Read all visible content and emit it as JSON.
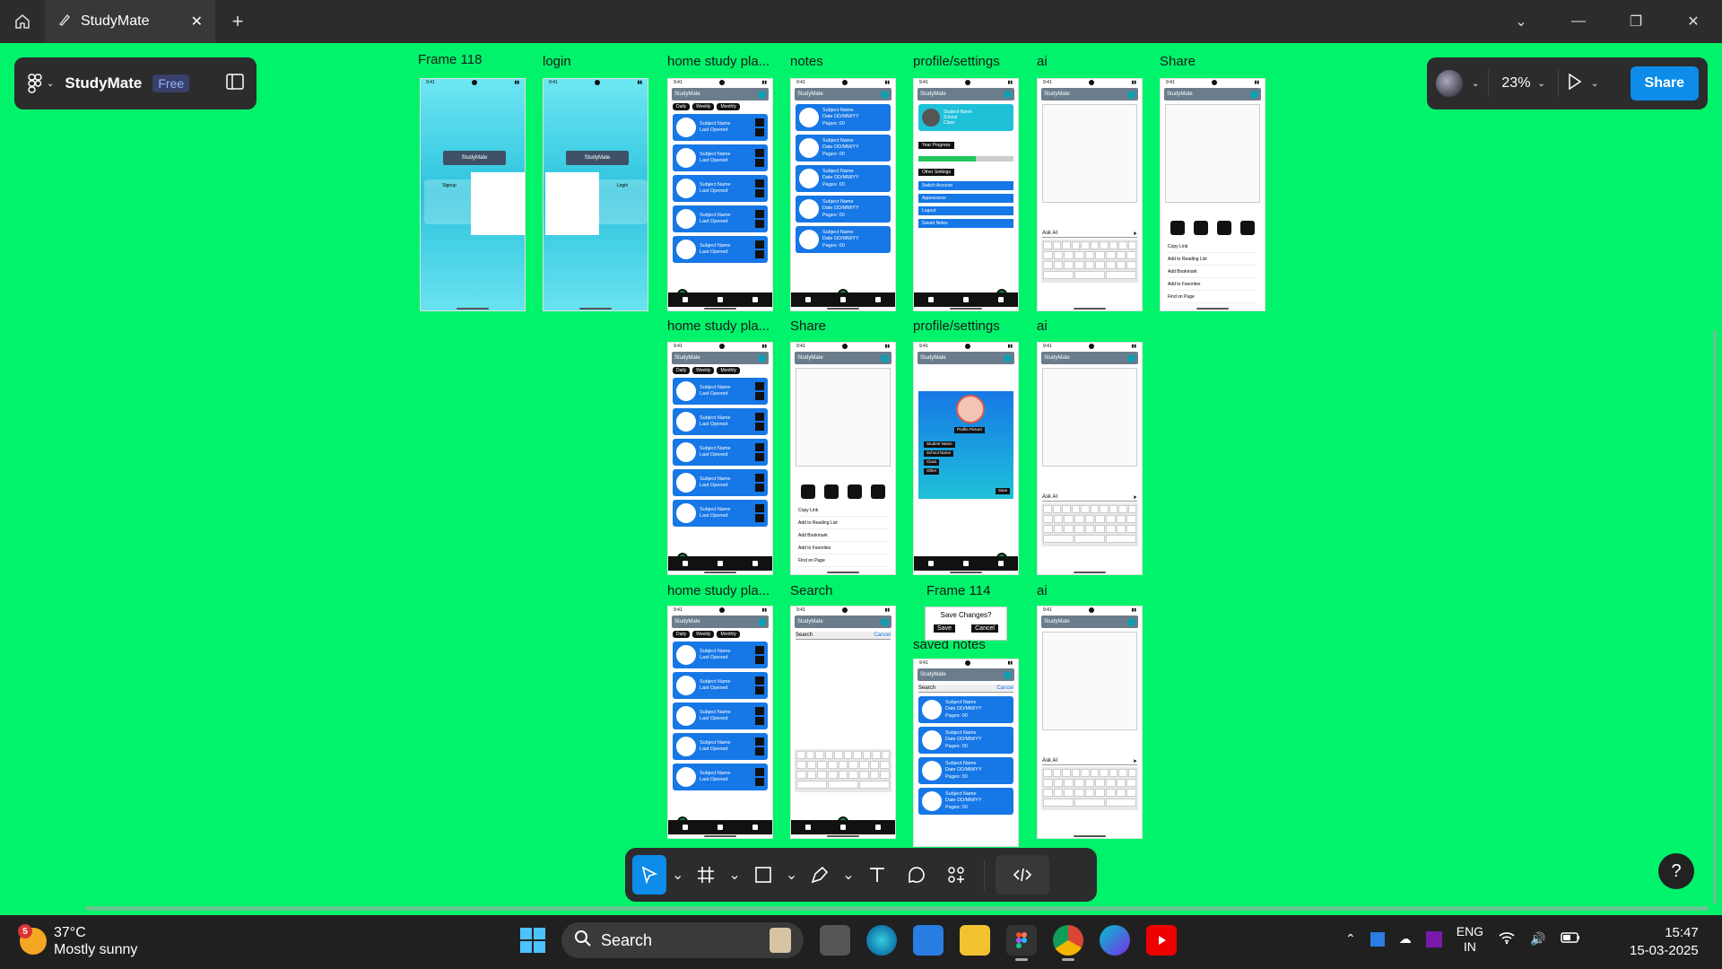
{
  "titlebar": {
    "tab_title": "StudyMate",
    "new_tab": "+"
  },
  "left_panel": {
    "title": "StudyMate",
    "plan_badge": "Free"
  },
  "right_panel": {
    "zoom": "23%",
    "share_label": "Share"
  },
  "frames": {
    "frame118": "Frame 118",
    "login": "login",
    "home1": "home study pla...",
    "notes": "notes",
    "profile1": "profile/settings",
    "ai1": "ai",
    "share1": "Share",
    "home2": "home study pla...",
    "share2": "Share",
    "profile2": "profile/settings",
    "ai2": "ai",
    "home3": "home study pla...",
    "search": "Search",
    "frame114": "Frame 114",
    "saved_notes": "saved notes",
    "ai3": "ai"
  },
  "mock": {
    "app_name": "StudyMate",
    "pills": [
      "Daily",
      "Weekly",
      "Monthly"
    ],
    "card_title": "Subject Name",
    "card_sub": "Last Opened",
    "note_title": "Subject Name",
    "note_date": "Date DD/MM/YY",
    "note_pages": "Pages: 00",
    "signup": "Signup",
    "login": "Login",
    "ask_ai": "Ask AI",
    "student_name": "Student Name",
    "school": "School",
    "class": "Class",
    "year_progress": "Year Progress",
    "other_settings": "Other Settings",
    "settings": [
      "Switch Account",
      "Appearance",
      "Logout",
      "Saved Notes"
    ],
    "share_list": [
      "Copy Link",
      "Add to Reading List",
      "Add Bookmark",
      "Add to Favorites",
      "Find on Page"
    ],
    "profile_picture": "Profile Picture",
    "profile_tags": [
      "Student Name",
      "School Name",
      "Class",
      "Other"
    ],
    "save": "Save",
    "cancel": "Cancel",
    "save_changes": "Save Changes?"
  },
  "taskbar": {
    "weather_badge": "5",
    "temperature": "37°C",
    "condition": "Mostly sunny",
    "search_placeholder": "Search",
    "lang_top": "ENG",
    "lang_bottom": "IN",
    "time": "15:47",
    "date": "15-03-2025"
  },
  "help": "?"
}
